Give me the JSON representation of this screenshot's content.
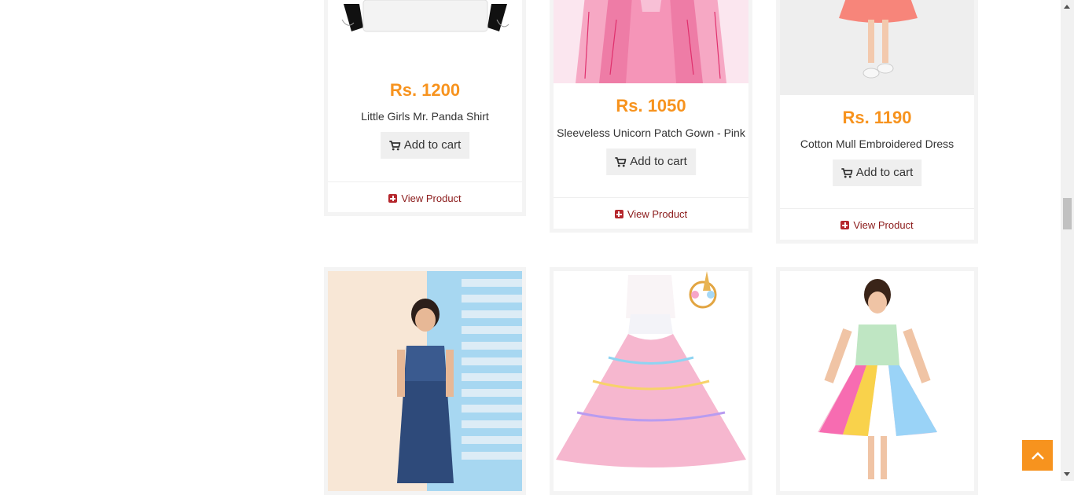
{
  "products_top": [
    {
      "price": "Rs. 1200",
      "name": "Little Girls Mr. Panda Shirt",
      "cart_label": "Add to cart",
      "view_label": "View Product"
    },
    {
      "price": "Rs. 1050",
      "name": "Sleeveless Unicorn Patch Gown - Pink",
      "cart_label": "Add to cart",
      "view_label": "View Product"
    },
    {
      "price": "Rs. 1190",
      "name": "Cotton Mull Embroidered Dress",
      "cart_label": "Add to cart",
      "view_label": "View Product"
    }
  ],
  "colors": {
    "price": "#f7931e",
    "link": "#8b1a1a",
    "back_to_top": "#f7931e"
  },
  "icons": {
    "cart": "shopping-cart-icon",
    "plus": "plus-square-icon",
    "back_to_top": "chevron-up-icon"
  }
}
